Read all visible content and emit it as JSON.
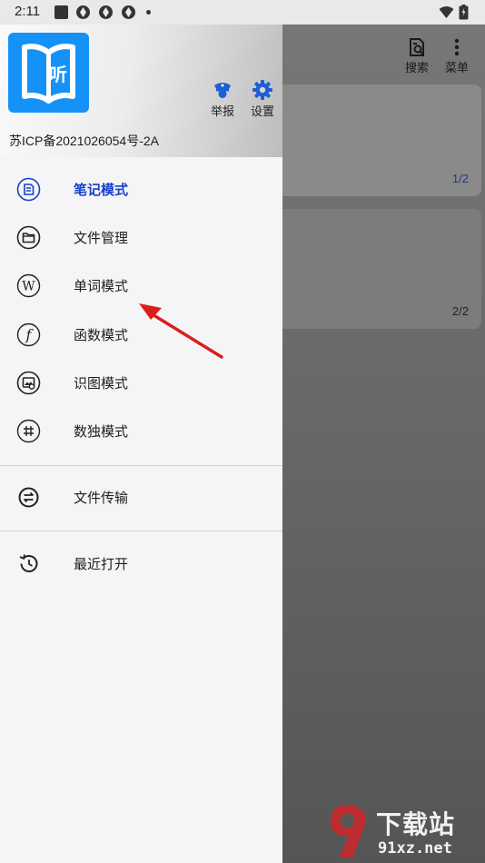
{
  "status_bar": {
    "time": "2:11",
    "icons": [
      "app-square-icon",
      "aperture-icon",
      "aperture-icon",
      "aperture-icon",
      "wifi-icon",
      "battery-icon"
    ]
  },
  "background_app": {
    "actions": [
      {
        "icon": "search-doc-icon",
        "label": "搜索"
      },
      {
        "icon": "menu-dots-icon",
        "label": "菜单"
      }
    ],
    "cards": [
      {
        "count": "1/2"
      },
      {
        "count": "2/2"
      }
    ]
  },
  "drawer": {
    "logo_text": "听",
    "actions": [
      {
        "icon": "police-cap-icon",
        "label": "举报"
      },
      {
        "icon": "gear-icon",
        "label": "设置"
      }
    ],
    "icp": "苏ICP备2021026054号-2A",
    "items": [
      {
        "icon": "note-icon",
        "label": "笔记模式",
        "active": true
      },
      {
        "icon": "folder-icon",
        "label": "文件管理",
        "active": false
      },
      {
        "icon": "w-letter-icon",
        "label": "单词模式",
        "active": false
      },
      {
        "icon": "function-icon",
        "label": "函数模式",
        "active": false
      },
      {
        "icon": "image-recognition-icon",
        "label": "识图模式",
        "active": false
      },
      {
        "icon": "hash-icon",
        "label": "数独模式",
        "active": false
      },
      {
        "icon": "transfer-icon",
        "label": "文件传输",
        "active": false
      },
      {
        "icon": "history-icon",
        "label": "最近打开",
        "active": false
      }
    ]
  },
  "watermark": {
    "text_top": "下载站",
    "text_bottom": "91xz.net"
  },
  "colors": {
    "accent": "#1841c8",
    "logo_blue": "#1592f7",
    "arrow_red": "#d9201c"
  }
}
